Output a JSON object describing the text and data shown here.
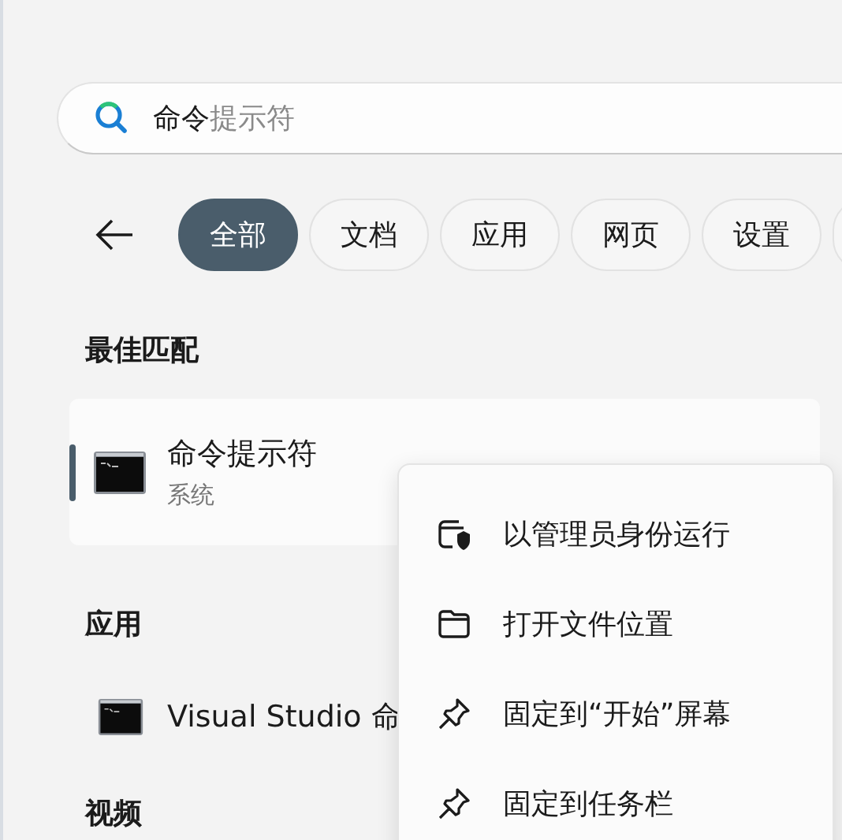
{
  "search": {
    "value": "命令",
    "suggestion": "提示符"
  },
  "filters": [
    {
      "label": "全部",
      "selected": true
    },
    {
      "label": "文档",
      "selected": false
    },
    {
      "label": "应用",
      "selected": false
    },
    {
      "label": "网页",
      "selected": false
    },
    {
      "label": "设置",
      "selected": false
    }
  ],
  "best_match": {
    "heading": "最佳匹配",
    "title": "命令提示符",
    "subtitle": "系统",
    "selected": true
  },
  "apps": {
    "heading": "应用",
    "items": [
      {
        "title": "Visual Studio 命"
      }
    ]
  },
  "videos": {
    "heading": "视频"
  },
  "context_menu": [
    {
      "kind": "admin",
      "label": "以管理员身份运行"
    },
    {
      "kind": "folder",
      "label": "打开文件位置"
    },
    {
      "kind": "pin",
      "label": "固定到“开始”屏幕"
    },
    {
      "kind": "pin",
      "label": "固定到任务栏"
    }
  ]
}
